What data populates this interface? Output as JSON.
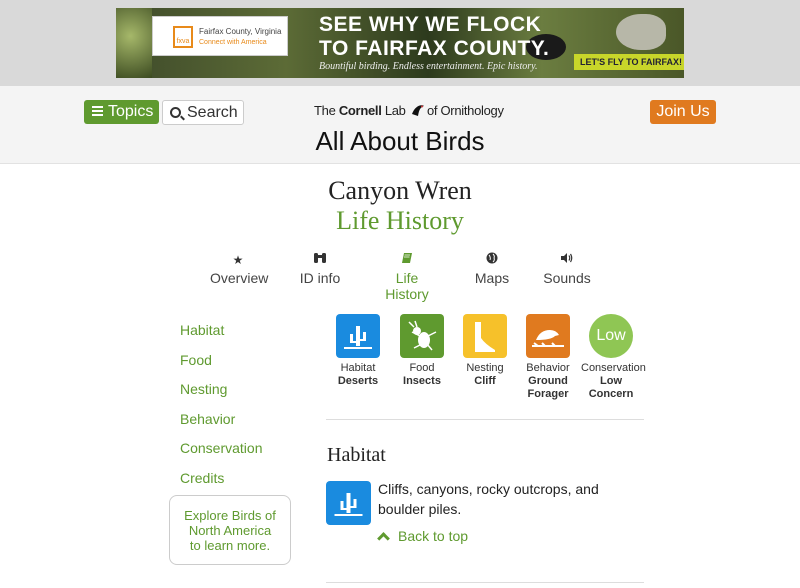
{
  "ad": {
    "card_line1": "Fairfax County, Virginia",
    "card_line2": "Connect with America",
    "logo_text": "fxva",
    "headline_line1": "SEE WHY WE FLOCK",
    "headline_line2": "TO FAIRFAX COUNTY.",
    "tagline": "Bountiful birding. Endless entertainment. Epic history.",
    "cta": "LET'S FLY TO FAIRFAX!"
  },
  "header": {
    "topics_label": "Topics",
    "search_label": "Search",
    "logo_the": "The ",
    "logo_cornell": "Cornell",
    "logo_lab": " Lab ",
    "logo_of": "of Ornithology",
    "site_title": "All About Birds",
    "join_label": "Join Us"
  },
  "page": {
    "species": "Canyon Wren",
    "subtitle": "Life History"
  },
  "tabs": [
    {
      "label": "Overview",
      "icon": "star-icon"
    },
    {
      "label": "ID info",
      "icon": "binoculars-icon"
    },
    {
      "label": "Life History",
      "icon": "book-icon"
    },
    {
      "label": "Maps",
      "icon": "globe-icon"
    },
    {
      "label": "Sounds",
      "icon": "speaker-icon"
    }
  ],
  "sidenav": [
    "Habitat",
    "Food",
    "Nesting",
    "Behavior",
    "Conservation",
    "Credits"
  ],
  "explore": {
    "line1": "Explore Birds of",
    "line2": "North America",
    "line3": "to learn more."
  },
  "cards": [
    {
      "cap": "Habitat",
      "val": "Deserts",
      "icon": "cactus-icon",
      "color": "#1a8bdf"
    },
    {
      "cap": "Food",
      "val": "Insects",
      "icon": "insect-icon",
      "color": "#5f9a2f"
    },
    {
      "cap": "Nesting",
      "val": "Cliff",
      "icon": "cliff-icon",
      "color": "#f6c12a"
    },
    {
      "cap": "Behavior",
      "val1": "Ground",
      "val2": "Forager",
      "icon": "ground-forager-icon",
      "color": "#e07a1f"
    },
    {
      "cap": "Conservation",
      "val1": "Low",
      "val2": "Concern",
      "badge": "Low",
      "color": "#8fc654"
    }
  ],
  "section": {
    "title": "Habitat",
    "text": "Cliffs, canyons, rocky outcrops, and boulder piles.",
    "back": "Back to top"
  },
  "colors": {
    "accent": "#5f9a2f",
    "join": "#e07a1f"
  }
}
